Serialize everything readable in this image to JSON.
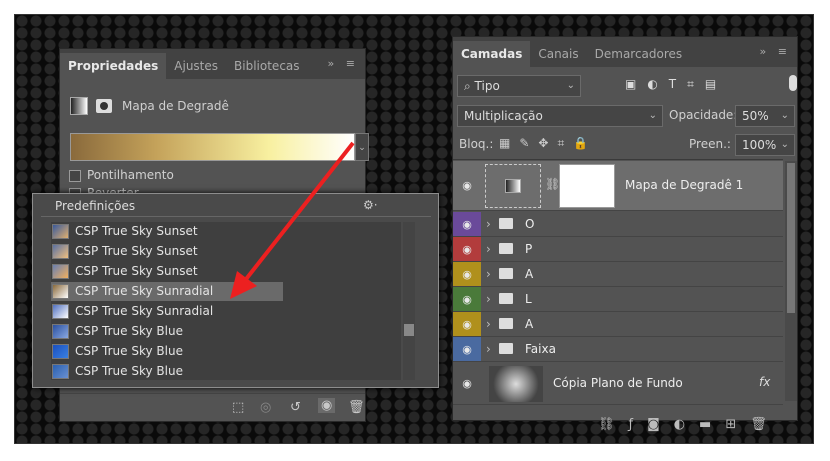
{
  "properties_panel": {
    "tabs": [
      "Propriedades",
      "Ajustes",
      "Bibliotecas"
    ],
    "tab_icons": "» ≡",
    "title": "Mapa de Degradê",
    "gradient_colors": [
      "#8a6a3c",
      "#c4a25a",
      "#f8f0a0",
      "#ffffff"
    ],
    "checkboxes": [
      "Pontilhamento",
      "Reverter"
    ],
    "bottom_icons": [
      "clip-to-layer-icon",
      "view-previous-icon",
      "reset-icon",
      "visibility-icon",
      "delete-icon"
    ]
  },
  "presets": {
    "title": "Predefinições",
    "items": [
      {
        "label": "CSP True Sky Sunset",
        "colors": [
          "#3a5a9a",
          "#e0b070"
        ]
      },
      {
        "label": "CSP True Sky Sunset",
        "colors": [
          "#5a70a0",
          "#f0c080"
        ]
      },
      {
        "label": "CSP True Sky Sunset",
        "colors": [
          "#6a80b0",
          "#f0b060"
        ]
      },
      {
        "label": "CSP True Sky Sunradial",
        "colors": [
          "#8a6a3c",
          "#ffffff"
        ]
      },
      {
        "label": "CSP True Sky Sunradial",
        "colors": [
          "#5070c0",
          "#ffffff"
        ]
      },
      {
        "label": "CSP True Sky Blue",
        "colors": [
          "#2a50a0",
          "#8aa8e0"
        ]
      },
      {
        "label": "CSP True Sky Blue",
        "colors": [
          "#1a50c0",
          "#3a80e0"
        ]
      },
      {
        "label": "CSP True Sky Blue",
        "colors": [
          "#2a60b0",
          "#6a90d0"
        ]
      }
    ],
    "selected_index": 3
  },
  "layers_panel": {
    "tabs": [
      "Camadas",
      "Canais",
      "Demarcadores"
    ],
    "tab_icons": "» ≡",
    "filter": "Tipo",
    "blend_mode": "Multiplicação",
    "opacity_label": "Opacidade:",
    "opacity_value": "50%",
    "lock_label": "Bloq.:",
    "fill_label": "Preen.:",
    "fill_value": "100%",
    "adjustment_layer": "Mapa de Degradê 1",
    "groups": [
      {
        "name": "O",
        "color": "#6a4a9a"
      },
      {
        "name": "P",
        "color": "#b23c3c"
      },
      {
        "name": "A",
        "color": "#b0901c"
      },
      {
        "name": "L",
        "color": "#4a7a3a"
      },
      {
        "name": "A",
        "color": "#b0901c"
      },
      {
        "name": "Faixa",
        "color": "#4a6aa0"
      }
    ],
    "bottom_layer": "Cópia Plano de Fundo",
    "fx_label": "fx"
  },
  "accent": "#ec2020"
}
